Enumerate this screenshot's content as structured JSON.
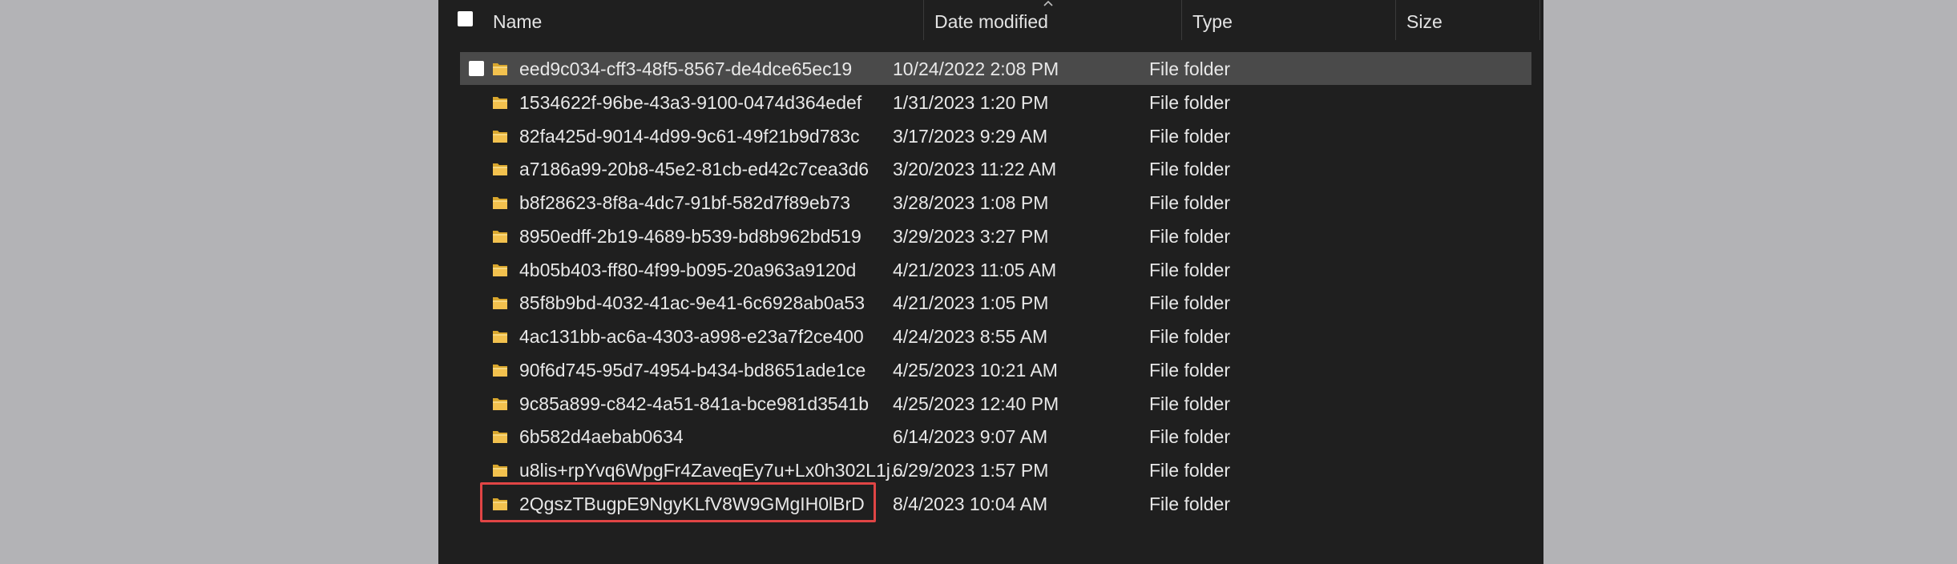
{
  "header": {
    "name_label": "Name",
    "date_label": "Date modified",
    "type_label": "Type",
    "size_label": "Size"
  },
  "rows": [
    {
      "name": "eed9c034-cff3-48f5-8567-de4dce65ec19",
      "date": "10/24/2022 2:08 PM",
      "type": "File folder",
      "selected": true
    },
    {
      "name": "1534622f-96be-43a3-9100-0474d364edef",
      "date": "1/31/2023 1:20 PM",
      "type": "File folder"
    },
    {
      "name": "82fa425d-9014-4d99-9c61-49f21b9d783c",
      "date": "3/17/2023 9:29 AM",
      "type": "File folder"
    },
    {
      "name": "a7186a99-20b8-45e2-81cb-ed42c7cea3d6",
      "date": "3/20/2023 11:22 AM",
      "type": "File folder"
    },
    {
      "name": "b8f28623-8f8a-4dc7-91bf-582d7f89eb73",
      "date": "3/28/2023 1:08 PM",
      "type": "File folder"
    },
    {
      "name": "8950edff-2b19-4689-b539-bd8b962bd519",
      "date": "3/29/2023 3:27 PM",
      "type": "File folder"
    },
    {
      "name": "4b05b403-ff80-4f99-b095-20a963a9120d",
      "date": "4/21/2023 11:05 AM",
      "type": "File folder"
    },
    {
      "name": "85f8b9bd-4032-41ac-9e41-6c6928ab0a53",
      "date": "4/21/2023 1:05 PM",
      "type": "File folder"
    },
    {
      "name": "4ac131bb-ac6a-4303-a998-e23a7f2ce400",
      "date": "4/24/2023 8:55 AM",
      "type": "File folder"
    },
    {
      "name": "90f6d745-95d7-4954-b434-bd8651ade1ce",
      "date": "4/25/2023 10:21 AM",
      "type": "File folder"
    },
    {
      "name": "9c85a899-c842-4a51-841a-bce981d3541b",
      "date": "4/25/2023 12:40 PM",
      "type": "File folder"
    },
    {
      "name": "6b582d4aebab0634",
      "date": "6/14/2023 9:07 AM",
      "type": "File folder"
    },
    {
      "name": "u8lis+rpYvq6WpgFr4ZaveqEy7u+Lx0h302L1j...",
      "date": "6/29/2023 1:57 PM",
      "type": "File folder"
    },
    {
      "name": "2QgszTBugpE9NgyKLfV8W9GMgIH0lBrD",
      "date": "8/4/2023 10:04 AM",
      "type": "File folder",
      "highlighted": true
    }
  ],
  "colors": {
    "background": "#b3b3b6",
    "panel": "#1f1f1f",
    "selected_row": "#4a4a4a",
    "folder": "#f2c14e",
    "highlight_border": "#e04545"
  },
  "icons": {
    "folder": "folder-icon",
    "checkbox": "checkbox-icon",
    "sort": "sort-ascending-icon"
  }
}
